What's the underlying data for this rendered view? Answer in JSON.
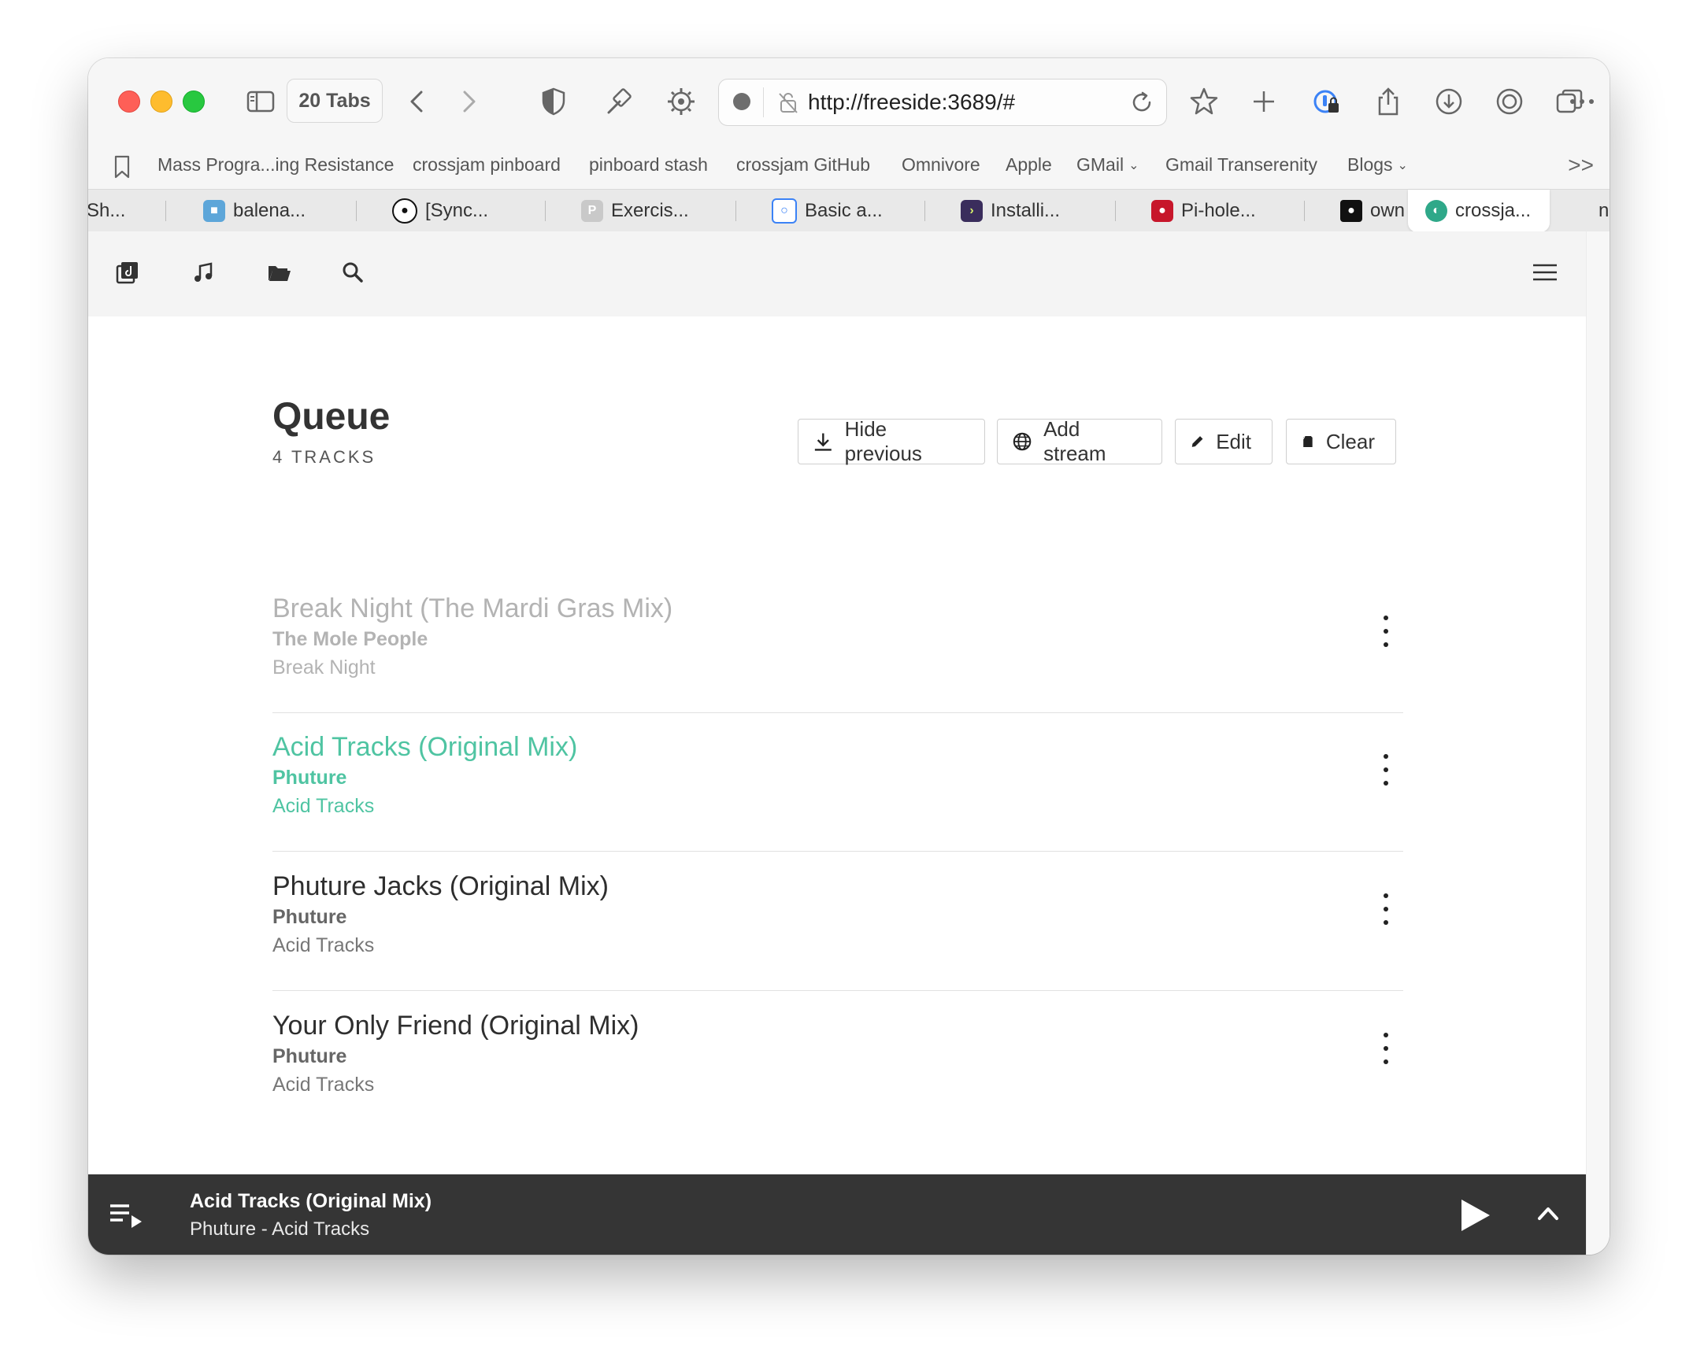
{
  "browser": {
    "tab_count_label": "20 Tabs",
    "url": "http://freeside:3689/#",
    "bookmarks": [
      {
        "label": "Mass Progra...ing Resistance",
        "menu": false
      },
      {
        "label": "crossjam pinboard",
        "menu": false
      },
      {
        "label": "pinboard stash",
        "menu": false
      },
      {
        "label": "crossjam GitHub",
        "menu": false
      },
      {
        "label": "Omnivore",
        "menu": false
      },
      {
        "label": "Apple",
        "menu": false
      },
      {
        "label": "GMail",
        "menu": true
      },
      {
        "label": "Gmail Transerenity",
        "menu": false
      },
      {
        "label": "Blogs",
        "menu": true
      }
    ],
    "overflow_label": ">>",
    "tabs": [
      {
        "label": "Sh...",
        "favicon": ""
      },
      {
        "label": "balena...",
        "favicon": "balena-icon"
      },
      {
        "label": "[Sync...",
        "favicon": "github-icon"
      },
      {
        "label": "Exercis...",
        "favicon": "p-icon"
      },
      {
        "label": "Basic a...",
        "favicon": "lock-icon"
      },
      {
        "label": "Installi...",
        "favicon": "terminal-icon"
      },
      {
        "label": "Pi-hole...",
        "favicon": "raspberry-icon"
      },
      {
        "label": "own",
        "favicon": "github-icon"
      },
      {
        "label": "crossja...",
        "favicon": "owntone-icon"
      },
      {
        "label": "n",
        "favicon": ""
      }
    ]
  },
  "app": {
    "nav_icons": [
      "library-icon",
      "music-note-icon",
      "folder-icon",
      "search-icon"
    ],
    "menu_icon": "hamburger-icon",
    "queue": {
      "title": "Queue",
      "count_label": "4 TRACKS",
      "buttons": {
        "hide_previous": "Hide previous",
        "add_stream": "Add stream",
        "edit": "Edit",
        "clear": "Clear"
      },
      "tracks": [
        {
          "title": "Break Night (The Mardi Gras Mix)",
          "artist": "The Mole People",
          "album": "Break Night",
          "state": "previous"
        },
        {
          "title": "Acid Tracks (Original Mix)",
          "artist": "Phuture",
          "album": "Acid Tracks",
          "state": "current"
        },
        {
          "title": "Phuture Jacks (Original Mix)",
          "artist": "Phuture",
          "album": "Acid Tracks",
          "state": "upcoming"
        },
        {
          "title": "Your Only Friend (Original Mix)",
          "artist": "Phuture",
          "album": "Acid Tracks",
          "state": "upcoming"
        }
      ]
    },
    "player": {
      "title": "Acid Tracks (Original Mix)",
      "subtitle": "Phuture - Acid Tracks"
    }
  },
  "colors": {
    "accent_current": "#4fc4a2",
    "previous_text": "#b3b3b3",
    "player_bg": "#353535"
  }
}
